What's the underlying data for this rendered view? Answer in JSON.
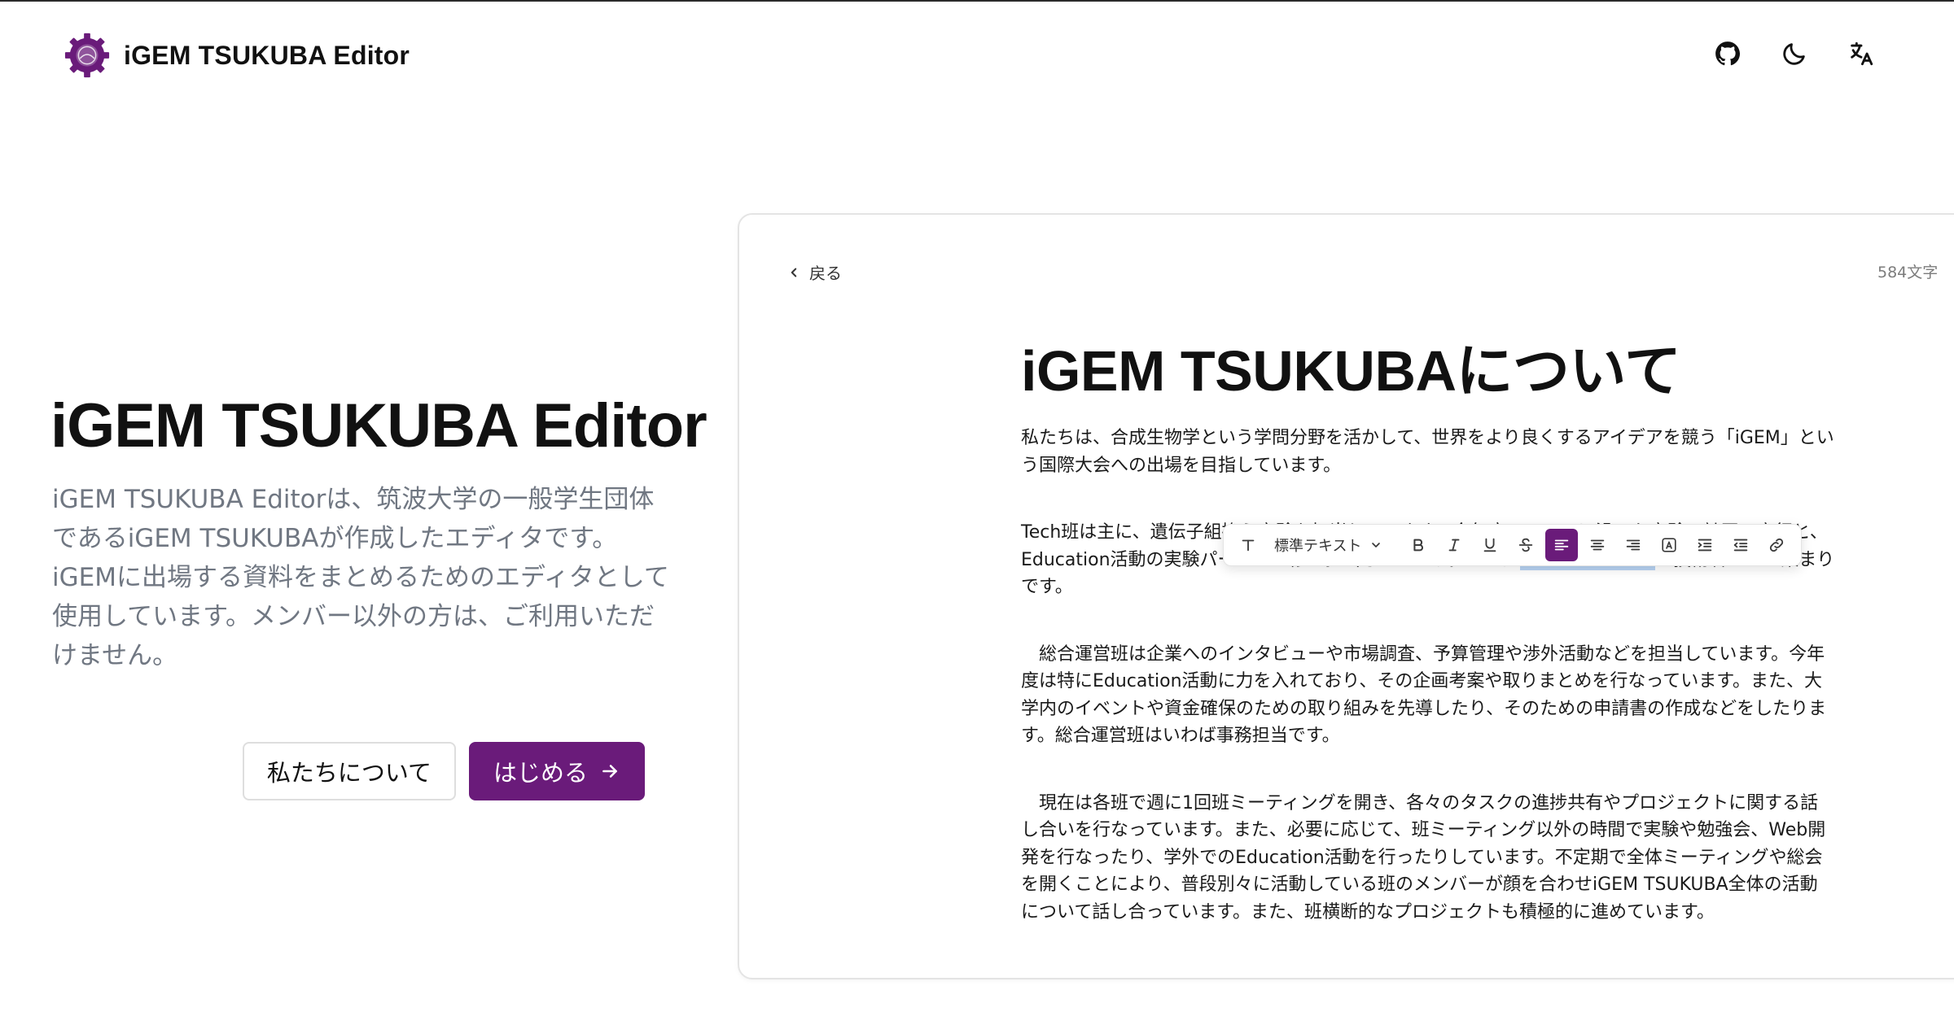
{
  "header": {
    "brand_name": "iGEM TSUKUBA Editor",
    "icons": [
      "github-icon",
      "moon-icon",
      "translate-icon"
    ]
  },
  "hero": {
    "title": "iGEM TSUKUBA Editor",
    "description": "iGEM TSUKUBA Editorは、筑波大学の一般学生団体であるiGEM TSUKUBAが作成したエディタです。iGEMに出場する資料をまとめるためのエディタとして使用しています。メンバー以外の方は、ご利用いただけません。",
    "about_button": "私たちについて",
    "start_button": "はじめる"
  },
  "editor": {
    "back_label": "戻る",
    "char_count": "584文字",
    "doc_title": "iGEM TSUKUBAについて",
    "paragraph1": "私たちは、合成生物学という学問分野を活かして、世界をより良くするアイデアを競う「iGEM」という国際大会への出場を目指しています。",
    "paragraph2_line1": "Tech班は主に、遺伝子組換え実験を担当しています。今年度のテーマに沿った実験の計画・実行と、Education活動の実験パートの監修を担当しています。いわば",
    "paragraph2_highlight": "iGEM TSUKUBA",
    "paragraph2_end": "の技術者たちの集まりです。",
    "paragraph3": "　総合運営班は企業へのインタビューや市場調査、予算管理や渉外活動などを担当しています。今年度は特にEducation活動に力を入れており、その企画考案や取りまとめを行なっています。また、大学内のイベントや資金確保のための取り組みを先導したり、そのための申請書の作成などをしたります。総合運営班はいわば事務担当です。",
    "paragraph4": "　現在は各班で週に1回班ミーティングを開き、各々のタスクの進捗共有やプロジェクトに関する話し合いを行なっています。また、必要に応じて、班ミーティング以外の時間で実験や勉強会、Web開発を行なったり、学外でのEducation活動を行ったりしています。不定期で全体ミーティングや総会を開くことにより、普段別々に活動している班のメンバーが顔を合わせiGEM TSUKUBA全体の活動について話し合っています。また、班横断的なプロジェクトも積極的に進めています。"
  },
  "toolbar": {
    "text_style": "標準テキスト",
    "buttons": [
      "text-type-icon",
      "bold-icon",
      "italic-icon",
      "underline-icon",
      "strikethrough-icon",
      "align-left-icon",
      "align-center-icon",
      "align-right-icon",
      "text-color-icon",
      "indent-icon",
      "outdent-icon",
      "link-icon"
    ],
    "active": "align-left-icon"
  },
  "colors": {
    "accent": "#6a1b7a",
    "selection": "#b7d3f3",
    "muted_text": "#707782"
  }
}
